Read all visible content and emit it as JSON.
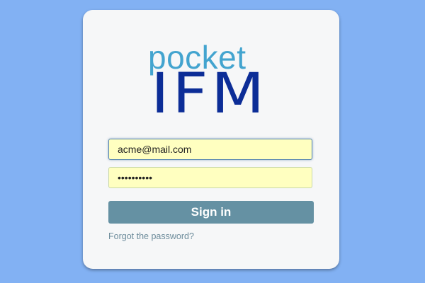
{
  "logo": {
    "top_text": "pocket",
    "bottom_text": "IFM",
    "top_color": "#43a4cf",
    "bottom_color": "#0c2d97"
  },
  "login": {
    "email_value": "acme@mail.com",
    "password_value": "••••••••••",
    "signin_label": "Sign in",
    "forgot_label": "Forgot the password?"
  },
  "colors": {
    "background": "#82b1f3",
    "card": "#f6f7f8",
    "input_fill": "#ffffc0",
    "button": "#6591a3",
    "link": "#6d8c9b"
  }
}
